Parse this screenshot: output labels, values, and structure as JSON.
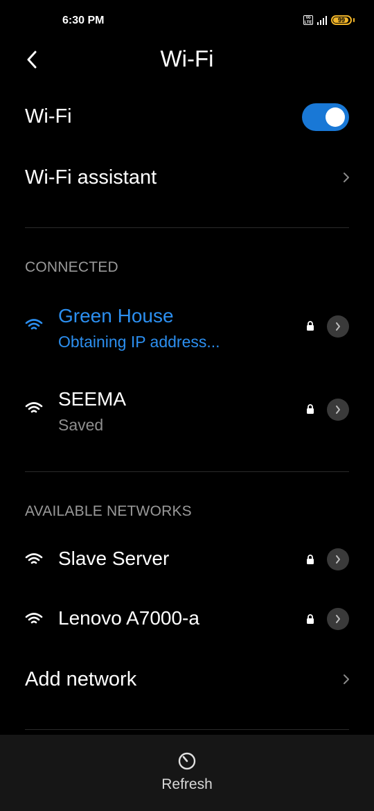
{
  "status_bar": {
    "time": "6:30 PM",
    "volte_label": "Vo LTE",
    "battery_level": "99",
    "icons": [
      "volte-icon",
      "signal-icon",
      "battery-icon"
    ]
  },
  "header": {
    "title": "Wi-Fi",
    "back_icon": "back-arrow-icon"
  },
  "wifi_toggle": {
    "label": "Wi-Fi",
    "enabled": true,
    "accent_color": "#1978d6"
  },
  "wifi_assistant": {
    "label": "Wi-Fi assistant"
  },
  "connected": {
    "section_label": "CONNECTED",
    "networks": [
      {
        "name": "Green House",
        "status": "Obtaining IP address...",
        "secured": true,
        "active": true,
        "color": "#2c8ff0"
      },
      {
        "name": "SEEMA",
        "status": "Saved",
        "secured": true,
        "active": false
      }
    ]
  },
  "available": {
    "section_label": "AVAILABLE NETWORKS",
    "networks": [
      {
        "name": "Slave Server",
        "secured": true
      },
      {
        "name": "Lenovo A7000-a",
        "secured": true
      }
    ]
  },
  "add_network": {
    "label": "Add network"
  },
  "bottom_bar": {
    "refresh_label": "Refresh",
    "refresh_icon": "refresh-icon"
  }
}
